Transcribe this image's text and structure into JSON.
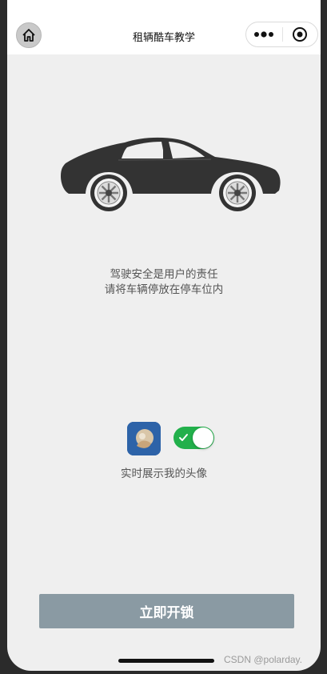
{
  "nav": {
    "title": "租辆酷车教学"
  },
  "notice": {
    "line1": "驾驶安全是用户的责任",
    "line2": "请将车辆停放在停车位内"
  },
  "avatar_share": {
    "label": "实时展示我的头像",
    "enabled": true
  },
  "unlock_button": {
    "label": "立即开锁"
  },
  "watermark": "CSDN @polarday.",
  "colors": {
    "toggle_on": "#22b04b",
    "button": "#8a9aa3",
    "background": "#efefef",
    "car": "#333333"
  },
  "icons": {
    "home": "home-icon",
    "more": "more-dots-icon",
    "close": "target-close-icon",
    "check": "check-icon",
    "car": "car-icon"
  }
}
